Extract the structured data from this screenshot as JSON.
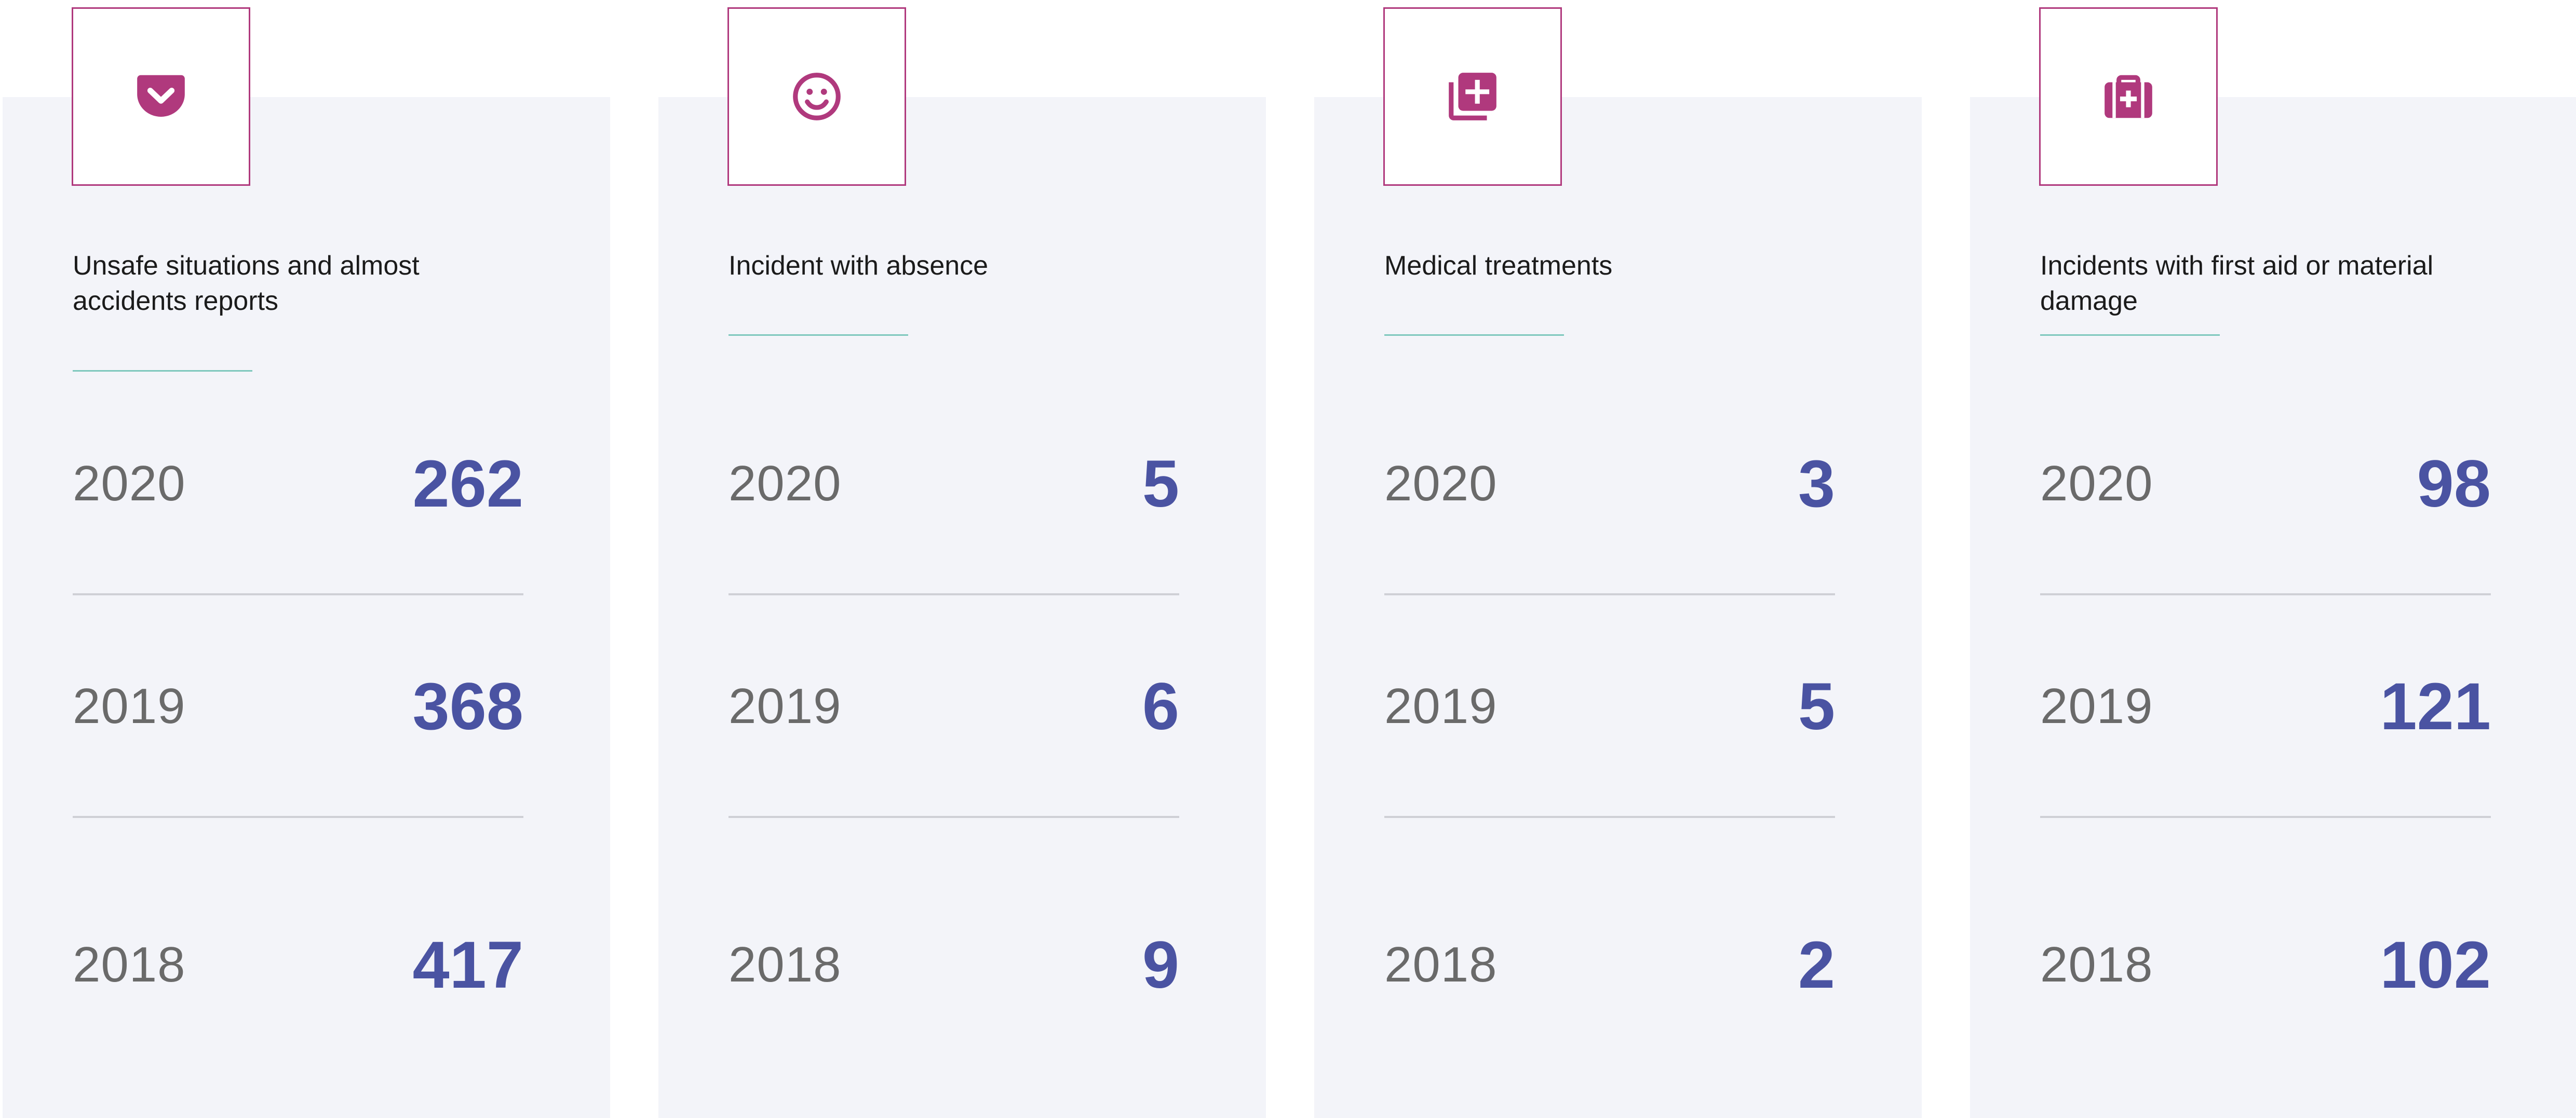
{
  "colors": {
    "accent_magenta": "#b0397d",
    "value_blue": "#4a53a2",
    "rule_teal": "#7ec8bd",
    "card_background": "#f3f4f9",
    "year_gray": "#6a6a6a"
  },
  "cards": [
    {
      "icon": "pocket-shield-icon",
      "title": "Unsafe situations and almost accidents reports",
      "rows": [
        {
          "year": "2020",
          "value": "262"
        },
        {
          "year": "2019",
          "value": "368"
        },
        {
          "year": "2018",
          "value": "417"
        }
      ]
    },
    {
      "icon": "smiley-face-icon",
      "title": "Incident with absence",
      "rows": [
        {
          "year": "2020",
          "value": "5"
        },
        {
          "year": "2019",
          "value": "6"
        },
        {
          "year": "2018",
          "value": "9"
        }
      ]
    },
    {
      "icon": "add-to-library-icon",
      "title": "Medical treatments",
      "rows": [
        {
          "year": "2020",
          "value": "3"
        },
        {
          "year": "2019",
          "value": "5"
        },
        {
          "year": "2018",
          "value": "2"
        }
      ]
    },
    {
      "icon": "medical-kit-icon",
      "title": "Incidents with first aid or material damage",
      "rows": [
        {
          "year": "2020",
          "value": "98"
        },
        {
          "year": "2019",
          "value": "121"
        },
        {
          "year": "2018",
          "value": "102"
        }
      ]
    }
  ]
}
